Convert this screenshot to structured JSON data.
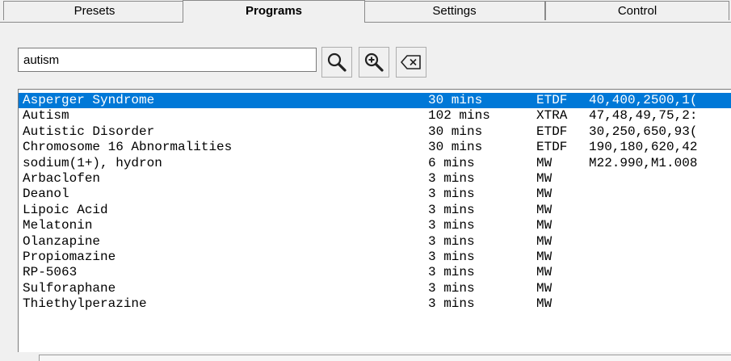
{
  "tabs": [
    {
      "label": "Presets",
      "active": false
    },
    {
      "label": "Programs",
      "active": true
    },
    {
      "label": "Settings",
      "active": false
    },
    {
      "label": "Control",
      "active": false
    }
  ],
  "search": {
    "value": "autism",
    "icons": [
      "search-icon",
      "zoom-in-icon",
      "clear-icon"
    ]
  },
  "colors": {
    "selection": "#0078d7",
    "selection_text": "#ffffff",
    "background": "#f0f0f0",
    "list_background": "#ffffff"
  },
  "results": [
    {
      "name": "Asperger Syndrome",
      "duration": "30 mins",
      "type": "ETDF",
      "frequencies": "40,400,2500,1(",
      "selected": true
    },
    {
      "name": "Autism",
      "duration": "102 mins",
      "type": "XTRA",
      "frequencies": "47,48,49,75,2:",
      "selected": false
    },
    {
      "name": "Autistic Disorder",
      "duration": "30 mins",
      "type": "ETDF",
      "frequencies": "30,250,650,93(",
      "selected": false
    },
    {
      "name": "Chromosome 16 Abnormalities",
      "duration": "30 mins",
      "type": "ETDF",
      "frequencies": "190,180,620,42",
      "selected": false
    },
    {
      "name": "sodium(1+), hydron",
      "duration": "6 mins",
      "type": "MW",
      "frequencies": "M22.990,M1.008",
      "selected": false
    },
    {
      "name": "Arbaclofen",
      "duration": "3 mins",
      "type": "MW",
      "frequencies": "",
      "selected": false
    },
    {
      "name": "Deanol",
      "duration": "3 mins",
      "type": "MW",
      "frequencies": "",
      "selected": false
    },
    {
      "name": "Lipoic Acid",
      "duration": "3 mins",
      "type": "MW",
      "frequencies": "",
      "selected": false
    },
    {
      "name": "Melatonin",
      "duration": "3 mins",
      "type": "MW",
      "frequencies": "",
      "selected": false
    },
    {
      "name": "Olanzapine",
      "duration": "3 mins",
      "type": "MW",
      "frequencies": "",
      "selected": false
    },
    {
      "name": "Propiomazine",
      "duration": "3 mins",
      "type": "MW",
      "frequencies": "",
      "selected": false
    },
    {
      "name": "RP-5063",
      "duration": "3 mins",
      "type": "MW",
      "frequencies": "",
      "selected": false
    },
    {
      "name": "Sulforaphane",
      "duration": "3 mins",
      "type": "MW",
      "frequencies": "",
      "selected": false
    },
    {
      "name": "Thiethylperazine",
      "duration": "3 mins",
      "type": "MW",
      "frequencies": "",
      "selected": false
    }
  ]
}
